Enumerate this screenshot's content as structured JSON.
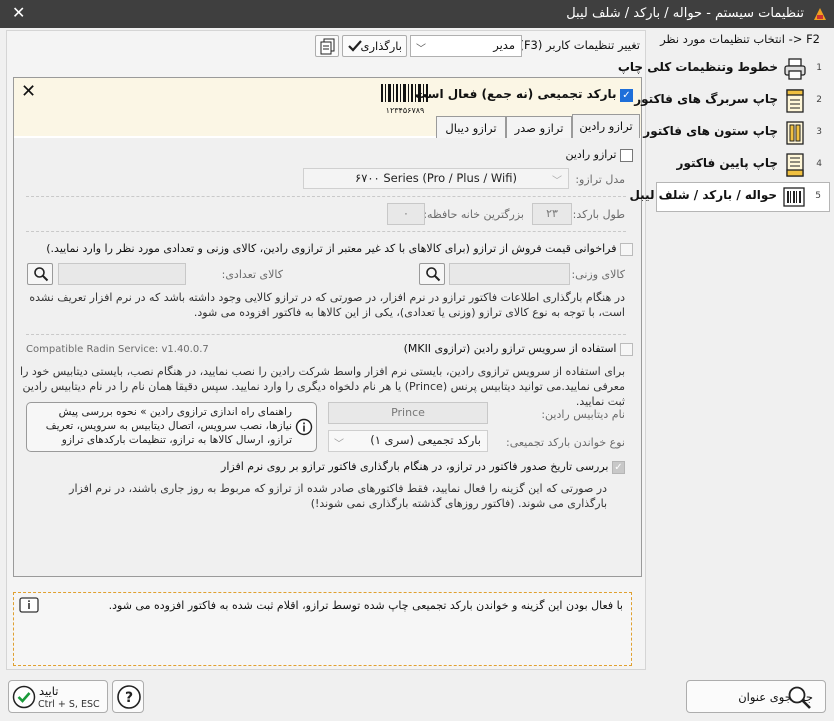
{
  "window": {
    "title": "تنظیمات سیستم - حواله / بارکد / شلف لیبل"
  },
  "sidebar": {
    "hint": "F2 <- انتخاب تنظیمات مورد نظر",
    "items": [
      {
        "num": "1",
        "label": "خطوط وتنظیمات کلی چاپ",
        "icon": "printer-icon"
      },
      {
        "num": "2",
        "label": "چاپ سربرگ های فاکتور",
        "icon": "page-header-icon"
      },
      {
        "num": "3",
        "label": "چاپ ستون های فاکتور",
        "icon": "columns-icon"
      },
      {
        "num": "4",
        "label": "چاپ پایین فاکتور",
        "icon": "page-footer-icon"
      },
      {
        "num": "5",
        "label": "حواله / بارکد / شلف لیبل",
        "icon": "barcode-icon"
      }
    ]
  },
  "toolbar": {
    "user_settings_label": "تغییر تنظیمات کاربر (F3):",
    "user_value": "مدیر",
    "load_button": "بارگذاری"
  },
  "panel": {
    "aggregate_barcode_label": "بارکد تجمیعی (نه جمع) فعال است",
    "barcode_digits": "۱۲۳۴۵۶۷۸۹",
    "tabs": [
      "ترازو رادین",
      "ترازو صدر",
      "ترازو دیبال"
    ],
    "radin_checkbox": "ترازو رادین",
    "model_label": "مدل ترازو:",
    "model_value": "۶۷۰۰ Series (Pro / Plus / Wifi)",
    "barcode_length_label": "طول بارکد:",
    "barcode_length_value": "۲۳",
    "largest_memory_label": "بزرگترین خانه حافظه:",
    "largest_memory_value": "۰",
    "fetch_price_label": "فراخوانی قیمت فروش از ترازو (برای کالاهای با کد غیر معتبر از ترازوی رادین، کالای وزنی و تعدادی مورد نظر را وارد نمایید.)",
    "weight_item_label": "کالای وزنی:",
    "count_item_label": "کالای تعدادی:",
    "fetch_note": "در هنگام بارگذاری اطلاعات فاکتور ترازو در نرم افزار، در صورتی که در ترازو کالایی وجود داشته باشد که در نرم افزار تعریف نشده است، با توجه به نوع کالای ترازو (وزنی یا تعدادی)، یکی از این کالاها به فاکتور افزوده می شود.",
    "service_checkbox": "استفاده از سرویس ترازو رادین (ترازوی MKII)",
    "service_version": "Compatible Radin Service: v1.40.0.7",
    "service_note": "برای استفاده از سرویس ترازوی رادین، بایستی نرم افزار واسط شرکت رادین را نصب نمایید، در هنگام نصب، بایستی دیتابیس خود را معرفی نمایید.می توانید دیتابیس پرنس (Prince) یا هر نام دلخواه دیگری را وارد نمایید. سپس دقیقا همان نام را در نام دیتابیس رادین ثبت نمایید.",
    "db_name_label": "نام دیتابیس رادین:",
    "db_name_value": "Prince",
    "read_type_label": "نوع خواندن بارکد تجمیعی:",
    "read_type_value": "بارکد تجمیعی (سری ۱)",
    "guide_text": "راهنمای راه اندازی ترازوی رادین » نحوه بررسی پیش نیازها، نصب سرویس، اتصال دیتابیس به سرویس، تعریف ترازو، ارسال کالاها به ترازو، تنظیمات بارکدهای ترازو",
    "check_date_label": "بررسی تاریخ صدور فاکتور در ترازو، در هنگام بارگذاری فاکتور ترازو بر روی نرم افزار",
    "check_date_note": "در صورتی که این گزینه را فعال نمایید، فقط فاکتورهای صادر شده از ترازو که مربوط به روز جاری باشند، در نرم افزار بارگذاری می شوند. (فاکتور روزهای گذشته بارگذاری نمی شوند!)"
  },
  "info_bar": {
    "text": "با فعال بودن این گزینه و خواندن بارکد تجمیعی چاپ شده توسط ترازو، اقلام ثبت شده به فاکتور افزوده می شود."
  },
  "footer": {
    "search_label": "جستجوی عنوان",
    "confirm_label": "تایید",
    "confirm_shortcut": "Ctrl + S, ESC"
  },
  "colors": {
    "accent": "#1e6fd9",
    "titlebar": "#3f3f3f",
    "info_border": "#e0a030"
  }
}
